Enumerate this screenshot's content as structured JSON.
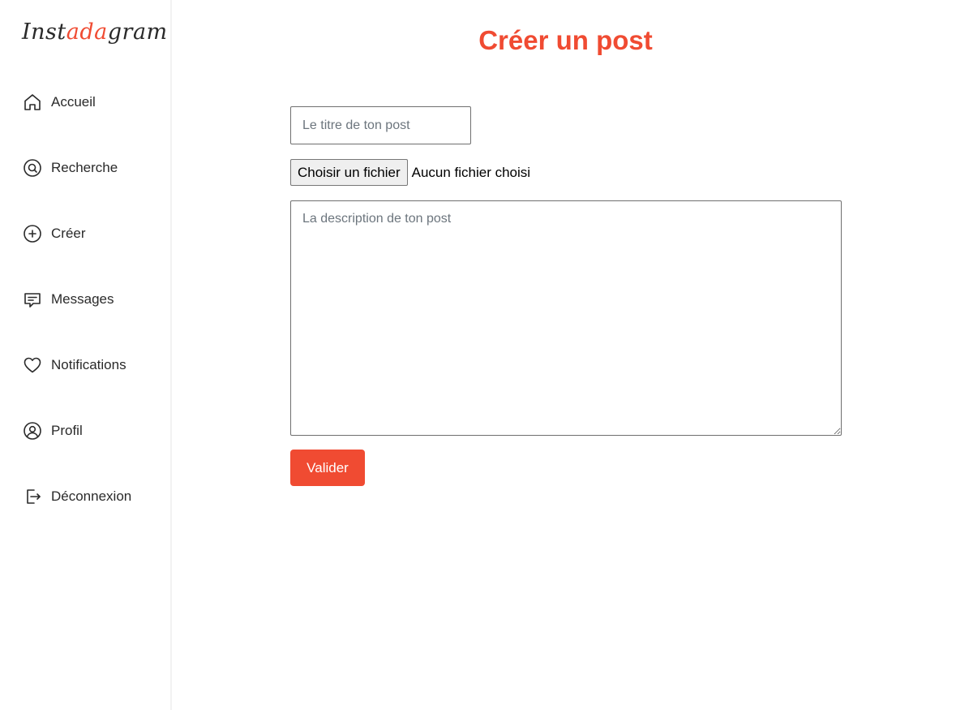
{
  "brand": {
    "logo_prefix": "Inst",
    "logo_accent": "ada",
    "logo_suffix": "gram",
    "accent_color": "#f04b32"
  },
  "sidebar": {
    "items": [
      {
        "label": "Accueil",
        "icon": "home-icon"
      },
      {
        "label": "Recherche",
        "icon": "search-icon"
      },
      {
        "label": "Créer",
        "icon": "plus-circle-icon"
      },
      {
        "label": "Messages",
        "icon": "message-icon"
      },
      {
        "label": "Notifications",
        "icon": "heart-icon"
      },
      {
        "label": "Profil",
        "icon": "user-circle-icon"
      },
      {
        "label": "Déconnexion",
        "icon": "logout-icon"
      }
    ]
  },
  "main": {
    "title": "Créer un post",
    "form": {
      "title_placeholder": "Le titre de ton post",
      "title_value": "",
      "file_button_label": "Choisir un fichier",
      "file_status": "Aucun fichier choisi",
      "description_placeholder": "La description de ton post",
      "description_value": "",
      "submit_label": "Valider"
    }
  }
}
